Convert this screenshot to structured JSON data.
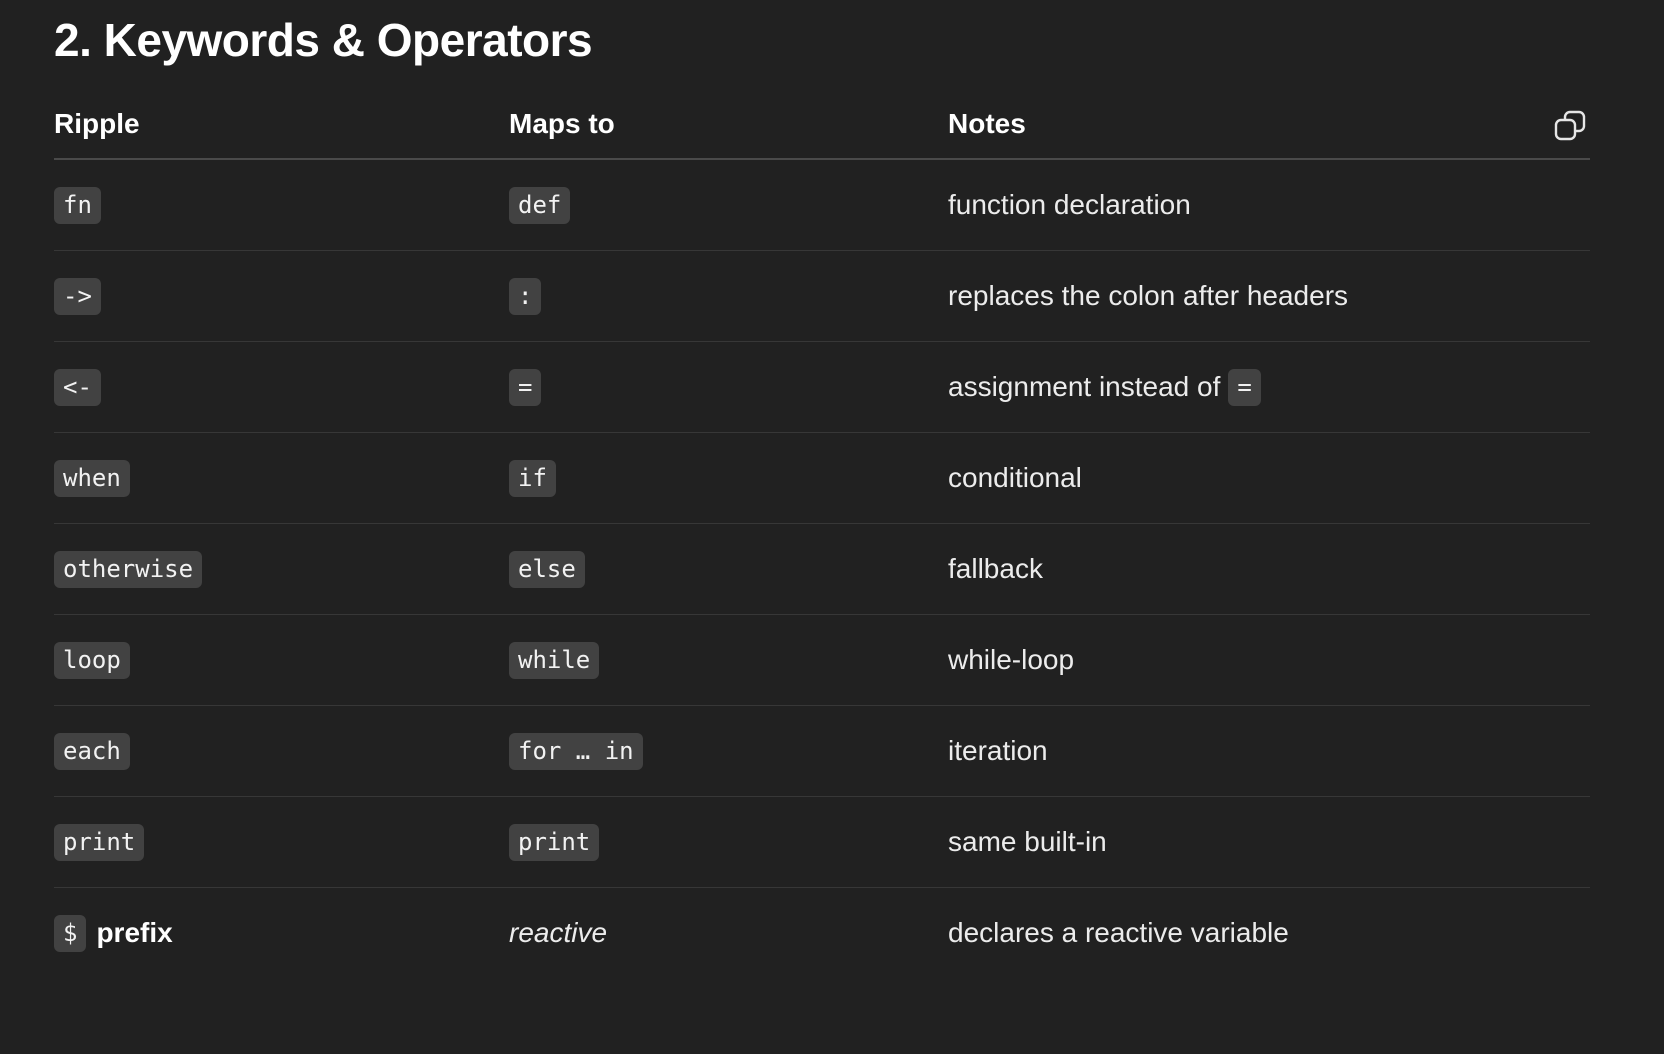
{
  "heading": "2. Keywords & Operators",
  "table": {
    "headers": [
      "Ripple",
      "Maps to",
      "Notes"
    ],
    "rows": [
      {
        "ripple": "fn",
        "maps": "def",
        "notes": "function declaration"
      },
      {
        "ripple": "->",
        "maps": ":",
        "notes": "replaces the colon after headers"
      },
      {
        "ripple": "<-",
        "maps": "=",
        "notes": "assignment instead of",
        "notes_code": "="
      },
      {
        "ripple": "when",
        "maps": "if",
        "notes": "conditional"
      },
      {
        "ripple": "otherwise",
        "maps": "else",
        "notes": "fallback"
      },
      {
        "ripple": "loop",
        "maps": "while",
        "notes": "while-loop"
      },
      {
        "ripple": "each",
        "maps": "for … in",
        "notes": "iteration"
      },
      {
        "ripple": "print",
        "maps": "print",
        "notes": "same built-in"
      },
      {
        "ripple": "$",
        "ripple_suffix": "prefix",
        "maps": "reactive",
        "notes": "declares a reactive variable"
      }
    ]
  },
  "icons": {
    "copy": "copy-icon"
  },
  "colors": {
    "background": "#212121",
    "code_bg": "#424242",
    "text": "#ececec"
  }
}
